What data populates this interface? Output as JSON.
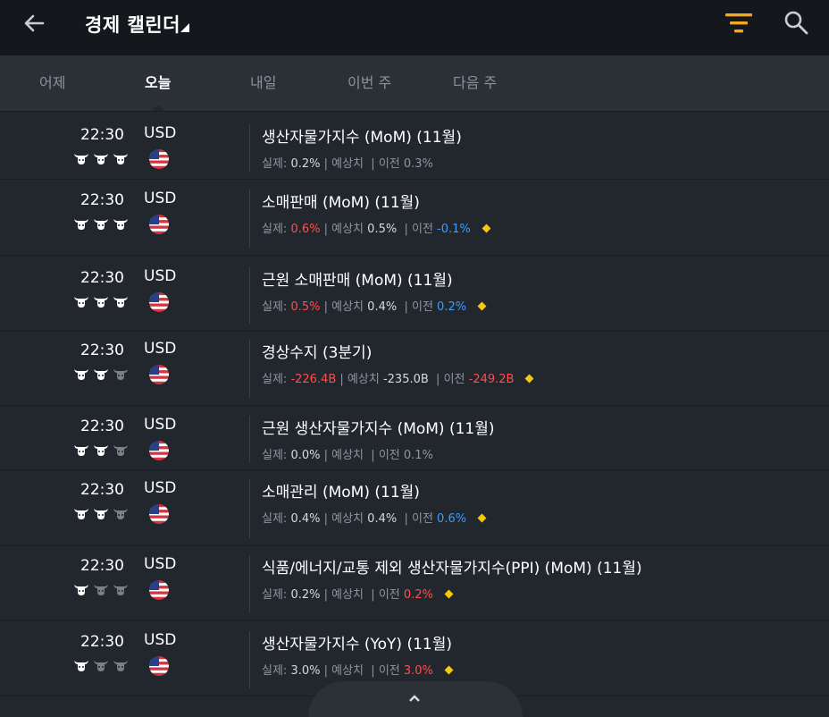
{
  "header": {
    "title": "경제 캘린더",
    "accent_color": "#f5a623",
    "icons": [
      "back-arrow-icon",
      "caret-icon",
      "filter-icon",
      "search-icon"
    ]
  },
  "tabs": [
    {
      "label": "어제",
      "active": false
    },
    {
      "label": "오늘",
      "active": true
    },
    {
      "label": "내일",
      "active": false
    },
    {
      "label": "이번 주",
      "active": false
    },
    {
      "label": "다음 주",
      "active": false
    }
  ],
  "labels": {
    "actual": "실제:",
    "forecast": "예상치",
    "previous": "이전"
  },
  "events": [
    {
      "time": "22:30",
      "currency": "USD",
      "importance": 3,
      "title": "생산자물가지수 (MoM) (11월)",
      "actual": "0.2%",
      "actual_color": "white",
      "forecast": "",
      "previous": "0.3%",
      "previous_color": "grey",
      "diamond": false
    },
    {
      "time": "22:30",
      "currency": "USD",
      "importance": 3,
      "title": "소매판매 (MoM) (11월)",
      "actual": "0.6%",
      "actual_color": "red",
      "forecast": "0.5%",
      "previous": "-0.1%",
      "previous_color": "blue",
      "diamond": true
    },
    {
      "time": "22:30",
      "currency": "USD",
      "importance": 3,
      "title": "근원 소매판매 (MoM) (11월)",
      "actual": "0.5%",
      "actual_color": "red",
      "forecast": "0.4%",
      "previous": "0.2%",
      "previous_color": "blue",
      "diamond": true
    },
    {
      "time": "22:30",
      "currency": "USD",
      "importance": 2,
      "title": "경상수지 (3분기)",
      "actual": "-226.4B",
      "actual_color": "red",
      "forecast": "-235.0B",
      "previous": "-249.2B",
      "previous_color": "red",
      "diamond": true
    },
    {
      "time": "22:30",
      "currency": "USD",
      "importance": 2,
      "title": "근원 생산자물가지수 (MoM) (11월)",
      "actual": "0.0%",
      "actual_color": "white",
      "forecast": "",
      "previous": "0.1%",
      "previous_color": "grey",
      "diamond": false
    },
    {
      "time": "22:30",
      "currency": "USD",
      "importance": 2,
      "title": "소매관리 (MoM) (11월)",
      "actual": "0.4%",
      "actual_color": "white",
      "forecast": "0.4%",
      "previous": "0.6%",
      "previous_color": "blue",
      "diamond": true
    },
    {
      "time": "22:30",
      "currency": "USD",
      "importance": 1,
      "title": "식품/에너지/교통 제외 생산자물가지수(PPI) (MoM) (11월)",
      "actual": "0.2%",
      "actual_color": "white",
      "forecast": "",
      "previous": "0.2%",
      "previous_color": "red",
      "diamond": true
    },
    {
      "time": "22:30",
      "currency": "USD",
      "importance": 1,
      "title": "생산자물가지수 (YoY) (11월)",
      "actual": "3.0%",
      "actual_color": "white",
      "forecast": "",
      "previous": "3.0%",
      "previous_color": "red",
      "diamond": true
    }
  ]
}
